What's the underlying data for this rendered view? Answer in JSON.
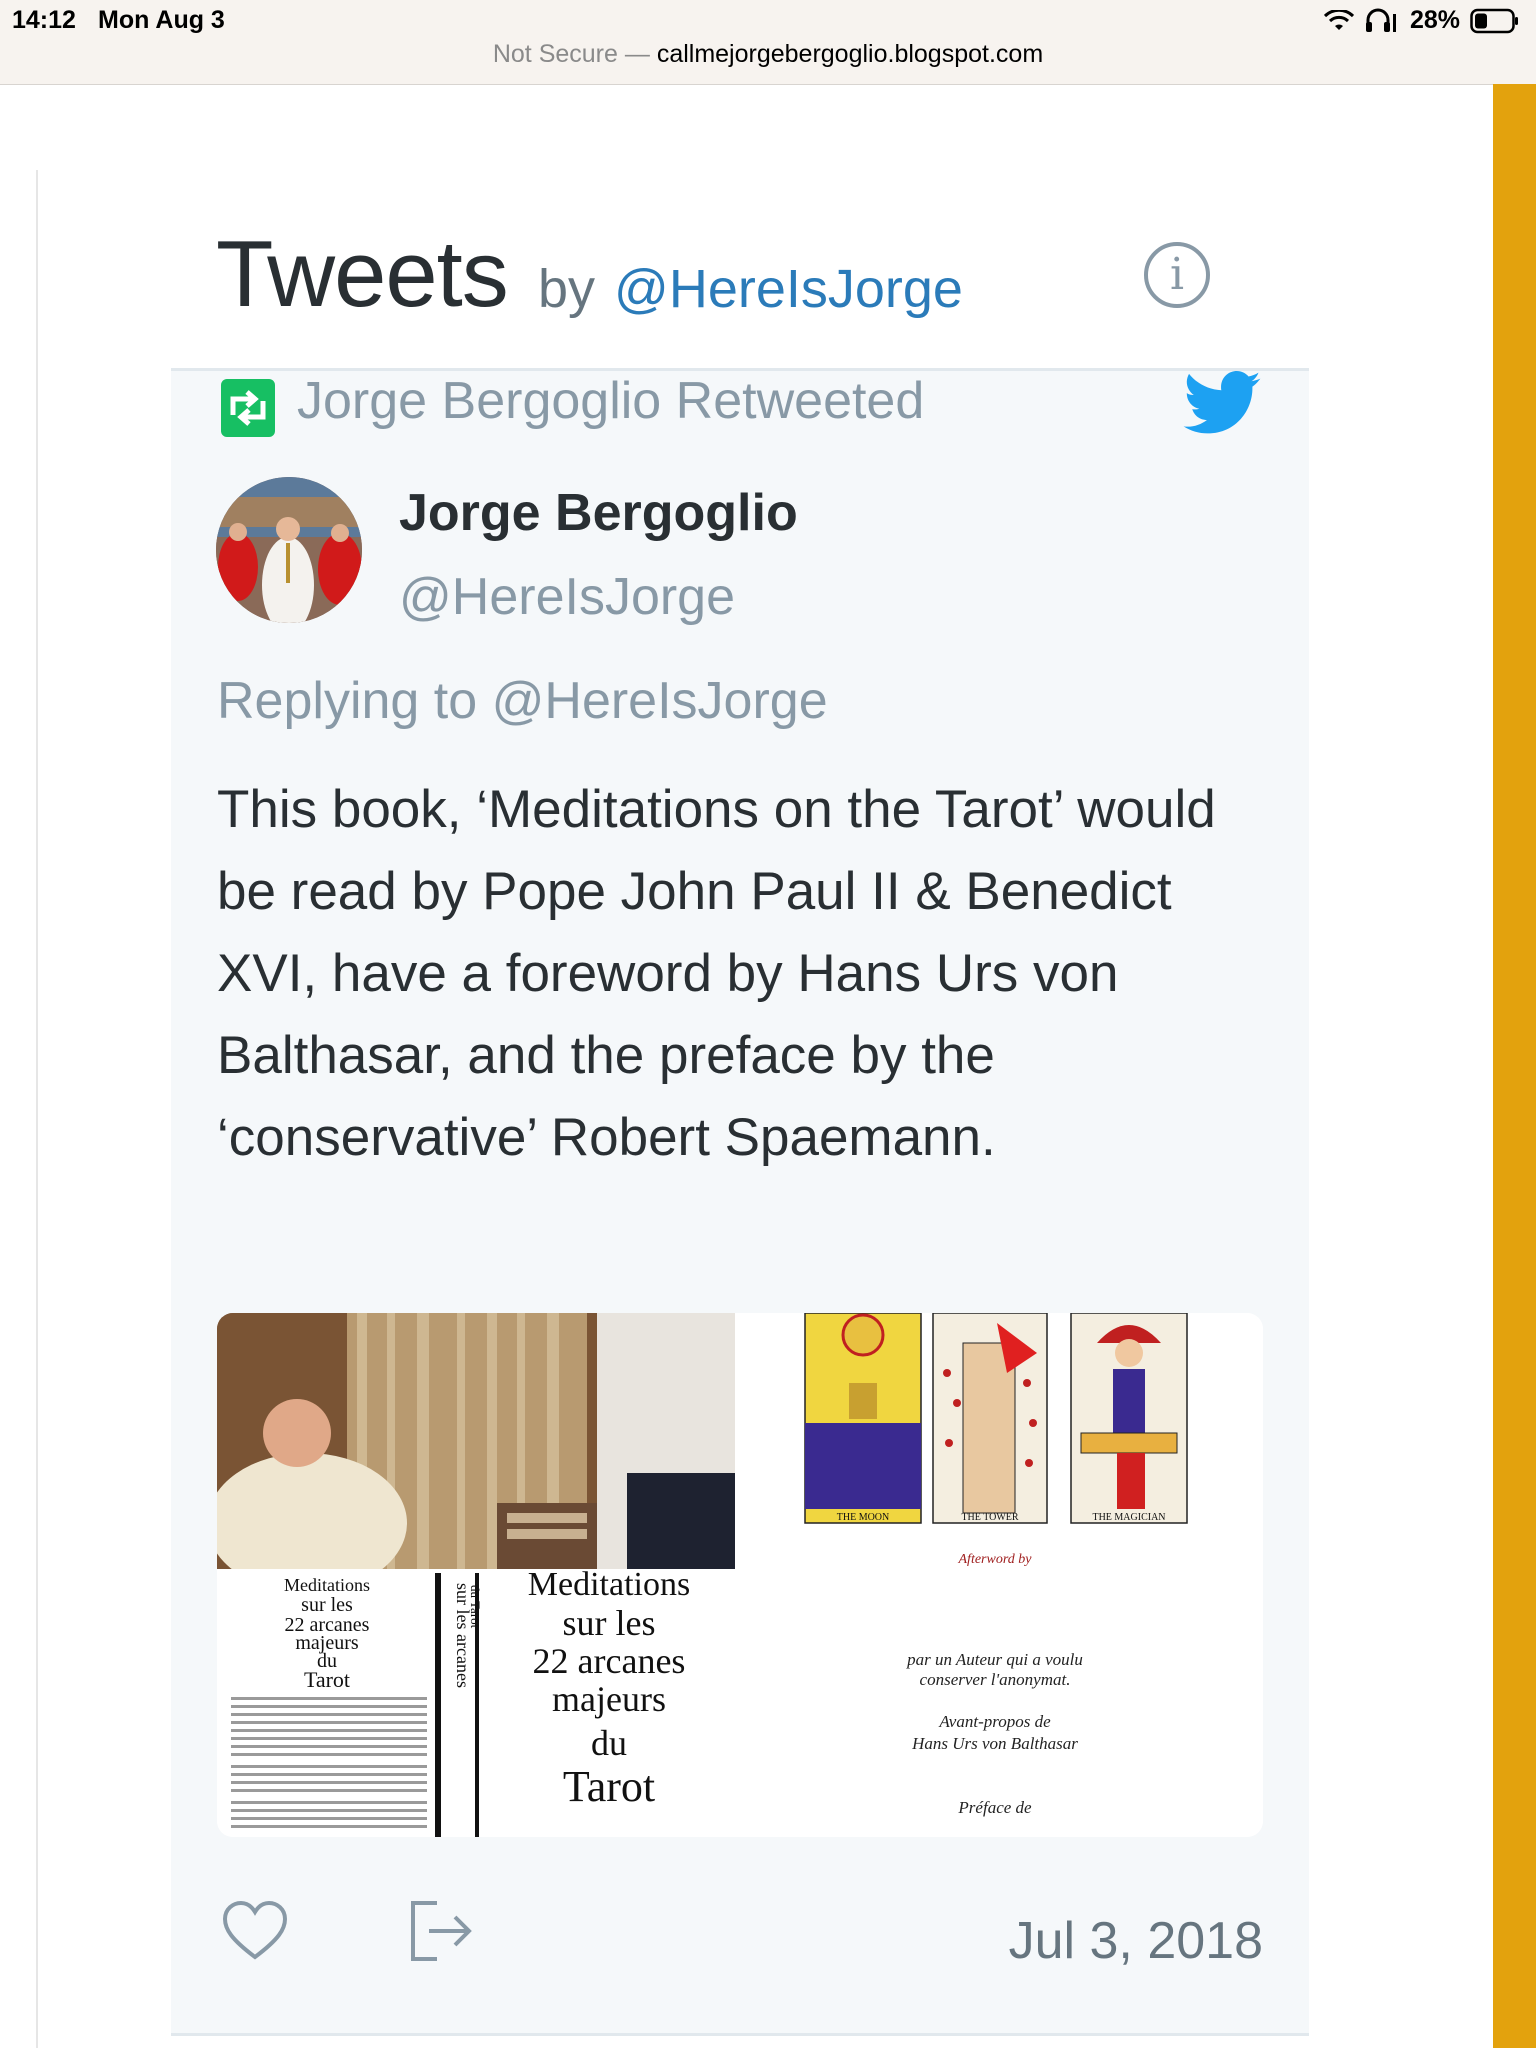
{
  "status_bar": {
    "time": "14:12",
    "date": "Mon Aug 3",
    "battery": "28%"
  },
  "browser": {
    "security": "Not Secure —",
    "host": "callmejorgebergoglio.blogspot.com"
  },
  "widget": {
    "title": "Tweets",
    "by": "by",
    "handle": "@HereIsJorge"
  },
  "tweet": {
    "retweet_label": "Jorge Bergoglio Retweeted",
    "author_name": "Jorge Bergoglio",
    "author_handle": "@HereIsJorge",
    "replying_to": "Replying to @HereIsJorge",
    "text": "This book, ‘Meditations on the Tarot’ would be read by Pope John Paul II & Benedict XVI, have a foreword by Hans Urs von Balthasar, and the preface by the ‘conservative’ Robert Spaemann.",
    "date": "Jul 3, 2018"
  },
  "media": {
    "cover_small_title": [
      "Meditations",
      "sur les",
      "22 arcanes",
      "majeurs",
      "du",
      "Tarot"
    ],
    "spine_text": [
      "sur les arcanes",
      "du Tarot"
    ],
    "cover_large_title": [
      "Meditations",
      "sur les",
      "22 arcanes",
      "majeurs",
      "du",
      "Tarot"
    ],
    "card_labels": [
      "THE MOON",
      "THE TOWER",
      "THE MAGICIAN"
    ],
    "afterword": "Afterword by",
    "anon_line1": "par un Auteur qui a voulu",
    "anon_line2": "conserver l'anonymat.",
    "avant_propos": "Avant-propos de",
    "balthasar": "Hans Urs von Balthasar",
    "preface": "Préface de"
  },
  "colors": {
    "accent_link": "#2b7bb9",
    "retweet_green": "#17bf63",
    "twitter_blue": "#1da1f2",
    "sidebar_gold": "#e3a20d"
  },
  "icons": [
    "retweet-icon",
    "twitter-bird-icon",
    "info-icon",
    "heart-icon",
    "share-icon",
    "wifi-icon",
    "headphones-icon",
    "battery-icon"
  ]
}
